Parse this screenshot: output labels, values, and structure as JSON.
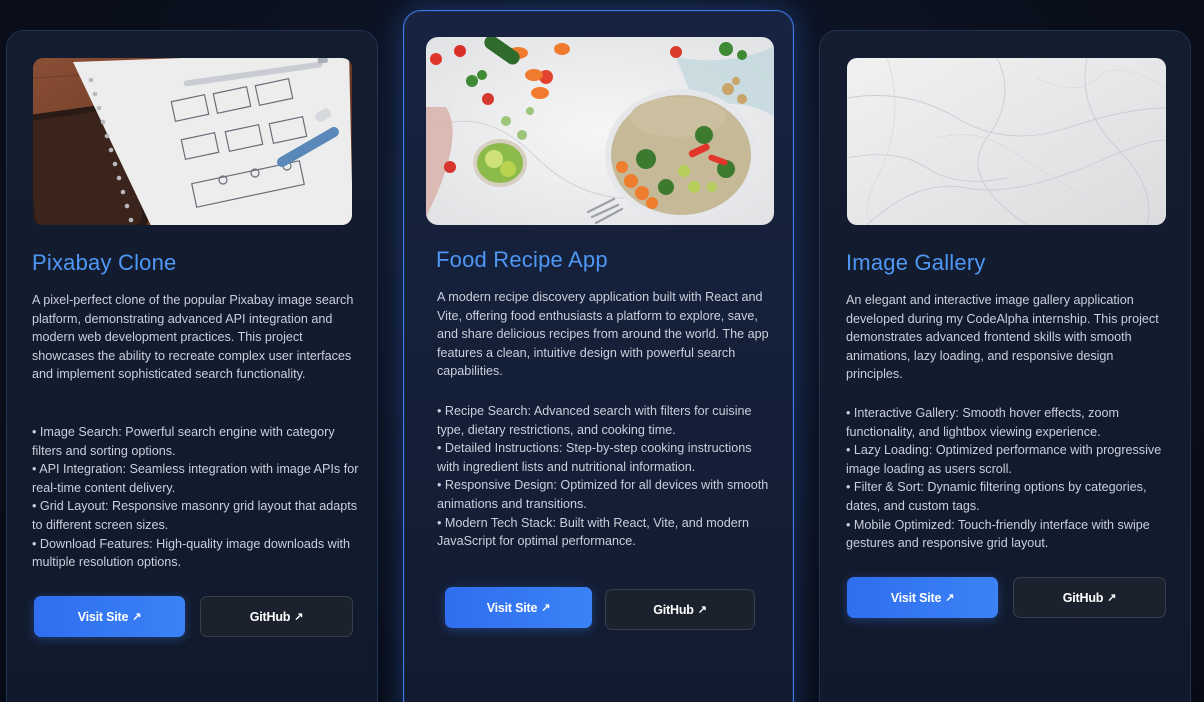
{
  "projects": [
    {
      "title": "Pixabay Clone",
      "description": "A pixel-perfect clone of the popular Pixabay image search platform, demonstrating advanced API integration and modern web development practices. This project showcases the ability to recreate complex user interfaces and implement sophisticated search functionality.",
      "features": [
        "• Image Search: Powerful search engine with category filters and sorting options.",
        "• API Integration: Seamless integration with image APIs for real-time content delivery.",
        "• Grid Layout: Responsive masonry grid layout that adapts to different screen sizes.",
        "• Download Features: High-quality image downloads with multiple resolution options."
      ],
      "visit_label": "Visit Site",
      "github_label": "GitHub",
      "thumbnail": "wireframe-sketch-notebook"
    },
    {
      "title": "Food Recipe App",
      "description": "A modern recipe discovery application built with React and Vite, offering food enthusiasts a platform to explore, save, and share delicious recipes from around the world. The app features a clean, intuitive design with powerful search capabilities.",
      "features": [
        "• Recipe Search: Advanced search with filters for cuisine type, dietary restrictions, and cooking time.",
        "• Detailed Instructions: Step-by-step cooking instructions with ingredient lists and nutritional information.",
        "• Responsive Design: Optimized for all devices with smooth animations and transitions.",
        "• Modern Tech Stack: Built with React, Vite, and modern JavaScript for optimal performance."
      ],
      "visit_label": "Visit Site",
      "github_label": "GitHub",
      "thumbnail": "salad-bowl-vegetables"
    },
    {
      "title": "Image Gallery",
      "description": "An elegant and interactive image gallery application developed during my CodeAlpha internship. This project demonstrates advanced frontend skills with smooth animations, lazy loading, and responsive design principles.",
      "features": [
        "• Interactive Gallery: Smooth hover effects, zoom functionality, and lightbox viewing experience.",
        "• Lazy Loading: Optimized performance with progressive image loading as users scroll.",
        "• Filter & Sort: Dynamic filtering options by categories, dates, and custom tags.",
        "• Mobile Optimized: Touch-friendly interface with swipe gestures and responsive grid layout."
      ],
      "visit_label": "Visit Site",
      "github_label": "GitHub",
      "thumbnail": "white-marble-texture"
    }
  ],
  "external_link_icon": "↗",
  "colors": {
    "accent": "#3b82f6",
    "title": "#4f97f5",
    "card_bg": "#141d30",
    "secondary_button": "#1c222d"
  }
}
